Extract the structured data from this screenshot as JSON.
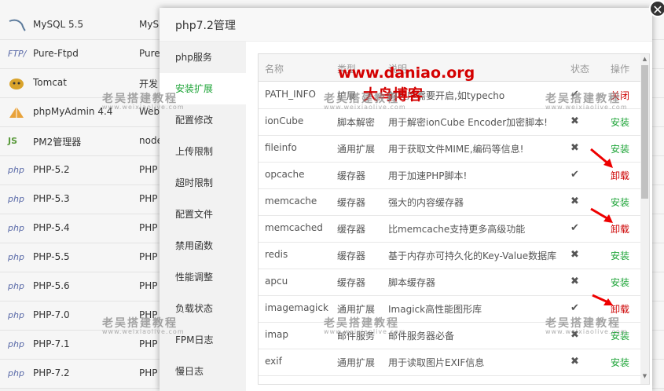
{
  "background_list": {
    "rows": [
      {
        "name": "MySQL 5.5",
        "col2": "MyS",
        "icon": "mysql-icon"
      },
      {
        "name": "Pure-Ftpd",
        "col2": "Pure",
        "icon": "ftp-icon"
      },
      {
        "name": "Tomcat",
        "col2": "开发",
        "icon": "tomcat-icon"
      },
      {
        "name": "phpMyAdmin 4.4",
        "col2": "Web",
        "icon": "phpmyadmin-icon"
      },
      {
        "name": "PM2管理器",
        "col2": "node",
        "icon": "nodejs-icon"
      },
      {
        "name": "PHP-5.2",
        "col2": "PHP",
        "icon": "php-icon"
      },
      {
        "name": "PHP-5.3",
        "col2": "PHP",
        "icon": "php-icon"
      },
      {
        "name": "PHP-5.4",
        "col2": "PHP",
        "icon": "php-icon"
      },
      {
        "name": "PHP-5.5",
        "col2": "PHP",
        "icon": "php-icon"
      },
      {
        "name": "PHP-5.6",
        "col2": "PHP",
        "icon": "php-icon"
      },
      {
        "name": "PHP-7.0",
        "col2": "PHP",
        "icon": "php-icon"
      },
      {
        "name": "PHP-7.1",
        "col2": "PHP",
        "icon": "php-icon"
      },
      {
        "name": "PHP-7.2",
        "col2": "PHP",
        "icon": "php-icon"
      }
    ],
    "icon_labels": {
      "ftp": "FTP/",
      "php": "php",
      "node": "JS"
    }
  },
  "modal": {
    "title": "php7.2管理",
    "close_glyph": "✕",
    "nav": [
      {
        "label": "php服务",
        "active": false
      },
      {
        "label": "安装扩展",
        "active": true
      },
      {
        "label": "配置修改",
        "active": false
      },
      {
        "label": "上传限制",
        "active": false
      },
      {
        "label": "超时限制",
        "active": false
      },
      {
        "label": "配置文件",
        "active": false
      },
      {
        "label": "禁用函数",
        "active": false
      },
      {
        "label": "性能调整",
        "active": false
      },
      {
        "label": "负载状态",
        "active": false
      },
      {
        "label": "FPM日志",
        "active": false
      },
      {
        "label": "慢日志",
        "active": false
      }
    ],
    "table": {
      "headers": {
        "name": "名称",
        "type": "类型",
        "desc": "说明",
        "status": "状态",
        "op": "操作"
      },
      "rows": [
        {
          "name": "PATH_INFO",
          "type": "扩展",
          "desc": "的程序需要开启,如typecho",
          "installed": true,
          "op": "关闭"
        },
        {
          "name": "ionCube",
          "type": "脚本解密",
          "desc": "用于解密ionCube Encoder加密脚本!",
          "installed": false,
          "op": "安装"
        },
        {
          "name": "fileinfo",
          "type": "通用扩展",
          "desc": "用于获取文件MIME,编码等信息!",
          "installed": false,
          "op": "安装"
        },
        {
          "name": "opcache",
          "type": "缓存器",
          "desc": "用于加速PHP脚本!",
          "installed": true,
          "op": "卸载"
        },
        {
          "name": "memcache",
          "type": "缓存器",
          "desc": "强大的内容缓存器",
          "installed": false,
          "op": "安装"
        },
        {
          "name": "memcached",
          "type": "缓存器",
          "desc": "比memcache支持更多高级功能",
          "installed": true,
          "op": "卸载"
        },
        {
          "name": "redis",
          "type": "缓存器",
          "desc": "基于内存亦可持久化的Key-Value数据库",
          "installed": false,
          "op": "安装"
        },
        {
          "name": "apcu",
          "type": "缓存器",
          "desc": "脚本缓存器",
          "installed": false,
          "op": "安装"
        },
        {
          "name": "imagemagick",
          "type": "通用扩展",
          "desc": "Imagick高性能图形库",
          "installed": true,
          "op": "卸载"
        },
        {
          "name": "imap",
          "type": "邮件服务",
          "desc": "邮件服务器必备",
          "installed": false,
          "op": "安装"
        },
        {
          "name": "exif",
          "type": "通用扩展",
          "desc": "用于读取图片EXIF信息",
          "installed": false,
          "op": "安装"
        }
      ],
      "status_glyphs": {
        "installed": "✔",
        "not_installed": "✖"
      },
      "scroll_up": "▲",
      "scroll_down": "▼"
    }
  },
  "watermarks": {
    "red_url": "www.daniao.org",
    "red_name": "大鸟博客",
    "gray_text": "老吴搭建教程",
    "gray_url": "www.weixiaolive.com"
  },
  "colors": {
    "accent": "#20a53a",
    "danger": "#cc0000",
    "watermark_red": "#d40000"
  }
}
